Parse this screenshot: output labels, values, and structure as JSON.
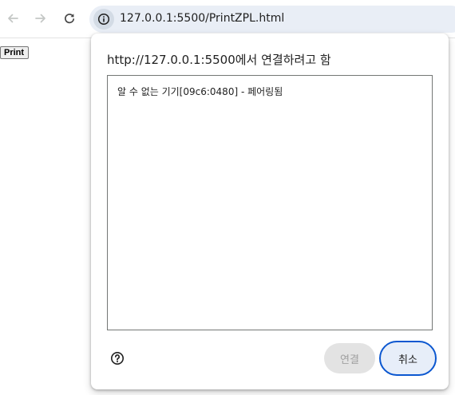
{
  "browser": {
    "url": "127.0.0.1:5500/PrintZPL.html",
    "icons": {
      "back": "arrow-left-icon",
      "forward": "arrow-right-icon",
      "reload": "reload-icon",
      "site_info": "info-icon"
    }
  },
  "page": {
    "print_button_label": "Print"
  },
  "dialog": {
    "title": "http://127.0.0.1:5500에서 연결하려고 함",
    "devices": [
      {
        "label": "알 수 없는 기기[09c6:0480] - 페어링됨"
      }
    ],
    "help_icon": "help-icon",
    "connect_label": "연결",
    "cancel_label": "취소"
  },
  "colors": {
    "accent": "#0b57d0",
    "omnibox": "#e9eef6",
    "disabled_button": "#e3e3e3"
  }
}
